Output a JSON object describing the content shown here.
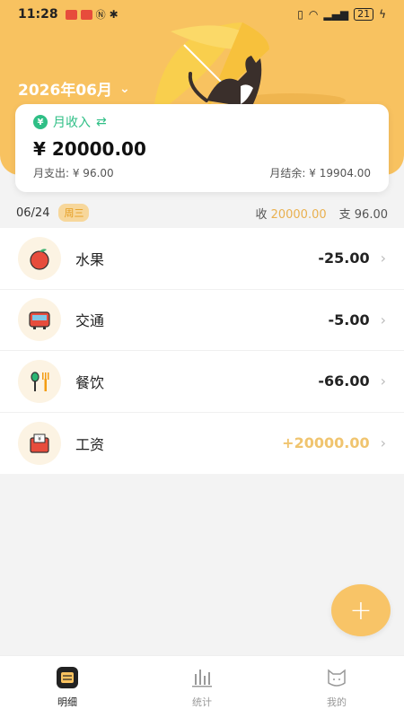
{
  "status_bar": {
    "time": "11:28",
    "battery": "21"
  },
  "header": {
    "month": "2026年06月"
  },
  "summary": {
    "income_label": "月收入",
    "income_amount": "¥ 20000.00",
    "expense_text": "月支出: ¥ 96.00",
    "balance_text": "月结余: ¥ 19904.00"
  },
  "day": {
    "date": "06/24",
    "weekday": "周三",
    "income_label": "收",
    "income_value": "20000.00",
    "expense_label": "支",
    "expense_value": "96.00"
  },
  "transactions": [
    {
      "category": "水果",
      "amount": "-25.00",
      "icon": "apple-icon"
    },
    {
      "category": "交通",
      "amount": "-5.00",
      "icon": "bus-icon"
    },
    {
      "category": "餐饮",
      "amount": "-66.00",
      "icon": "utensils-icon"
    },
    {
      "category": "工资",
      "amount": "+20000.00",
      "icon": "salary-envelope-icon"
    }
  ],
  "fab": {
    "label": "+"
  },
  "nav": [
    {
      "label": "明细",
      "icon": "detail-list-icon",
      "active": true
    },
    {
      "label": "统计",
      "icon": "stats-bars-icon",
      "active": false
    },
    {
      "label": "我的",
      "icon": "cat-profile-icon",
      "active": false
    }
  ],
  "colors": {
    "accent": "#f8c260",
    "income_green": "#2fbf86",
    "positive_amount": "#f0c46e"
  }
}
